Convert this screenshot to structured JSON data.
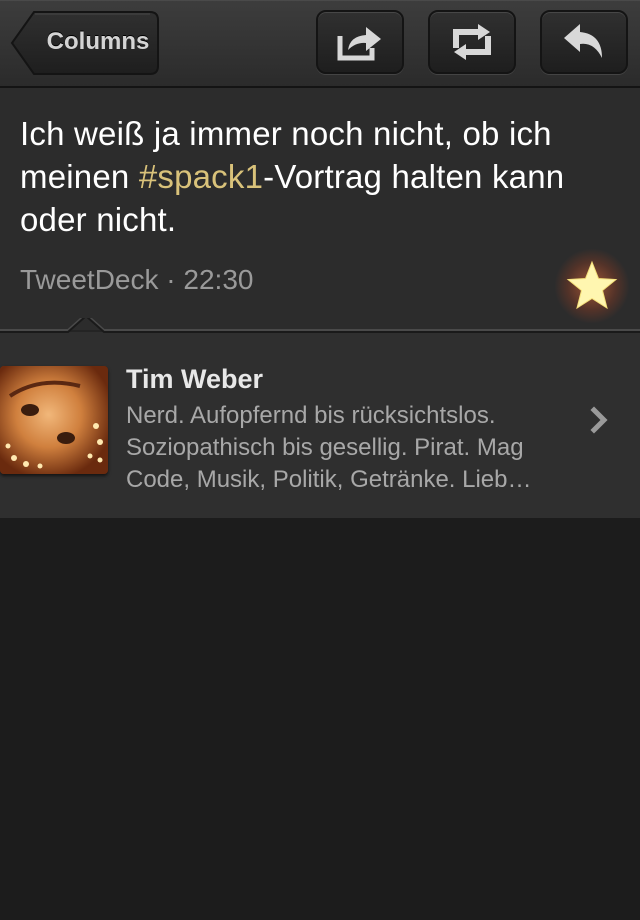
{
  "toolbar": {
    "back_label": "Columns",
    "buttons": [
      {
        "icon": "share-icon"
      },
      {
        "icon": "retweet-icon"
      },
      {
        "icon": "reply-icon"
      }
    ]
  },
  "tweet": {
    "text_before": "Ich weiß ja immer noch nicht, ob ich meinen ",
    "hashtag": "#spack1",
    "text_after": "-Vortrag halten kann oder nicht.",
    "source": "TweetDeck",
    "separator": "·",
    "time": "22:30",
    "favorited": true,
    "favorite_icon": "star-icon"
  },
  "user": {
    "name": "Tim Weber",
    "bio_lines": [
      "Nerd. Aufopfernd bis rücksichtslos.",
      "Soziopathisch bis gesellig. Pirat. Mag",
      "Code, Musik, Politik, Getränke. Lieb…"
    ]
  },
  "colors": {
    "hashtag": "#d9c27a",
    "star": "#fff6b0",
    "background": "#1c1c1c"
  }
}
